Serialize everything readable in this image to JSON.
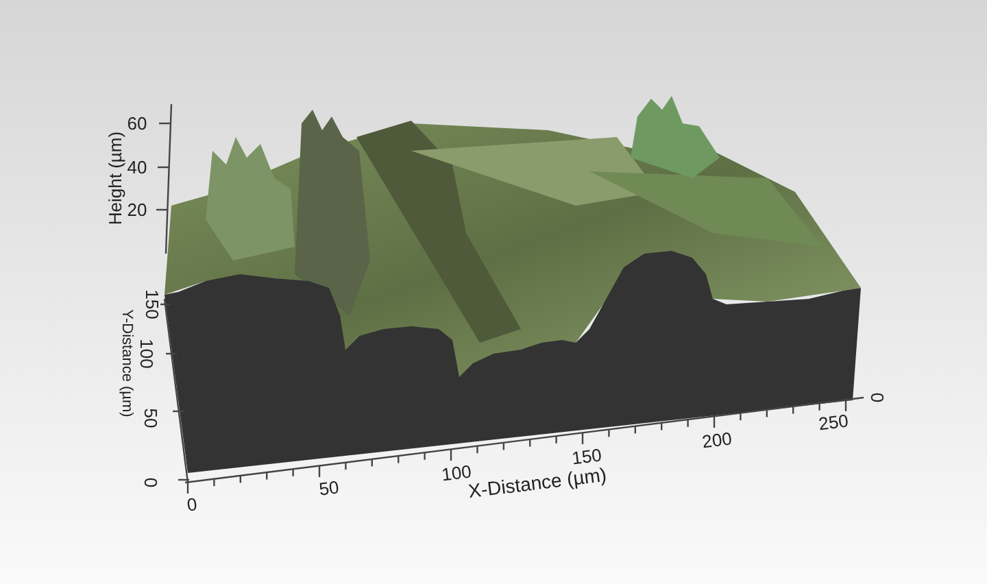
{
  "figure": {
    "z_axis": {
      "label": "Height (µm)",
      "ticks": [
        "60",
        "40",
        "20"
      ]
    },
    "y_axis": {
      "label": "Y-Distance (µm)",
      "ticks": [
        "150",
        "100",
        "50",
        "0"
      ]
    },
    "x_axis": {
      "label": "X-Distance (µm)",
      "ticks": [
        "0",
        "50",
        "100",
        "150",
        "200",
        "250"
      ]
    },
    "corner_label": "0"
  }
}
